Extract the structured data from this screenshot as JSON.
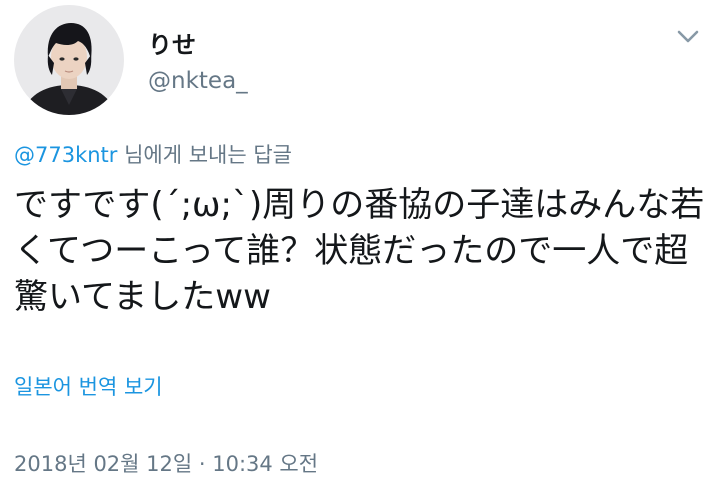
{
  "author": {
    "display_name": "りせ",
    "handle": "@nktea_"
  },
  "reply": {
    "mention": "@773kntr",
    "suffix": " 님에게 보내는 답글"
  },
  "tweet": {
    "text": "ですです(´;ω;`)周りの番協の子達はみんな若くてつーこって誰？状態だったので一人で超驚いてましたww"
  },
  "actions": {
    "translate_label": "일본어 번역 보기"
  },
  "meta": {
    "timestamp": "2018년 02월 12일 · 10:34 오전"
  },
  "icons": {
    "menu": "chevron-down-icon"
  },
  "colors": {
    "link": "#1b95e0",
    "secondary_text": "#657786",
    "primary_text": "#14171a"
  }
}
